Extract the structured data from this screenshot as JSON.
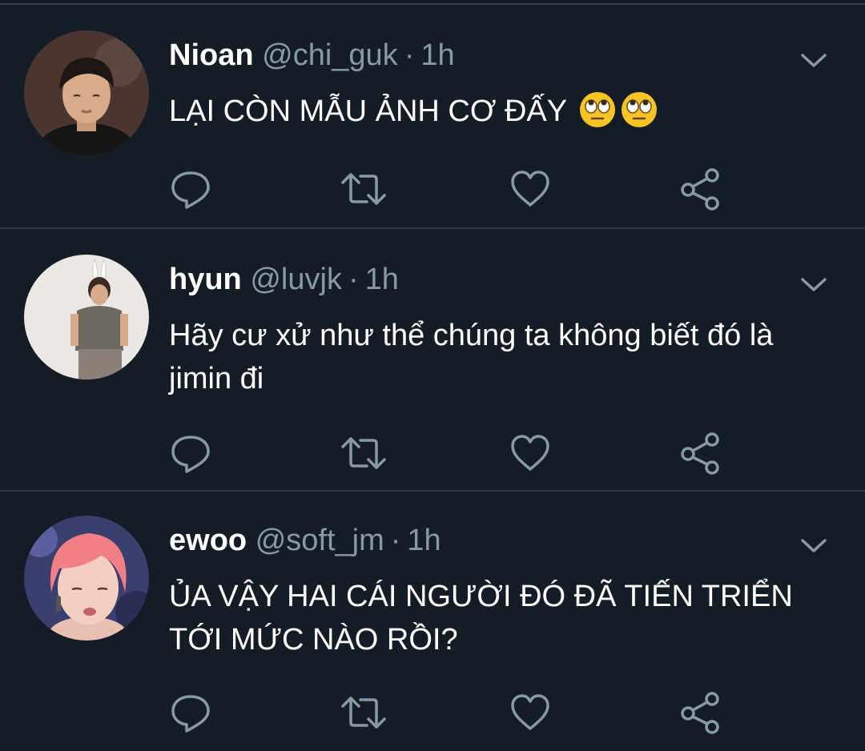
{
  "tweets": [
    {
      "name": "Nioan",
      "handle": "@chi_guk",
      "separator": "·",
      "time": "1h",
      "text": "LẠI CÒN MẪU ẢNH CƠ ĐẤY",
      "emoji": [
        "face-with-rolling-eyes-icon",
        "face-with-rolling-eyes-icon"
      ]
    },
    {
      "name": "hyun",
      "handle": "@luvjk",
      "separator": "·",
      "time": "1h",
      "text": "Hãy cư xử như thể chúng ta không biết đó là jimin đi"
    },
    {
      "name": "ewoo",
      "handle": "@soft_jm",
      "separator": "·",
      "time": "1h",
      "text": "ỦA VẬY HAI CÁI NGƯỜI ĐÓ ĐÃ TIẾN TRIỂN TỚI MỨC NÀO RỒI?"
    }
  ],
  "icons": {
    "reply": "reply-icon",
    "retweet": "retweet-icon",
    "like": "heart-icon",
    "share": "share-icon",
    "menu": "chevron-down-icon"
  },
  "colors": {
    "background": "#141d26",
    "divider": "#2f3b46",
    "secondary_text": "#8899a6",
    "icon": "#8899a6",
    "primary_text": "#ffffff"
  }
}
